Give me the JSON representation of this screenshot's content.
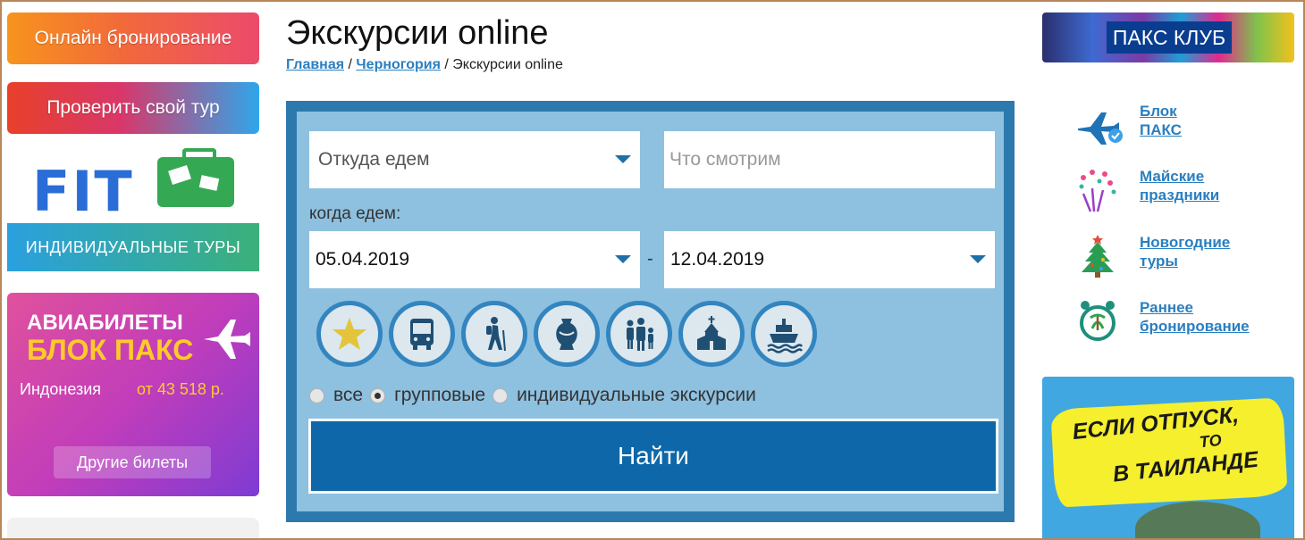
{
  "left": {
    "online_booking": "Онлайн бронирование",
    "check_tour": "Проверить свой тур",
    "fit": {
      "title": "FIT",
      "subtitle": "ИНДИВИДУАЛЬНЫЕ ТУРЫ"
    },
    "avia": {
      "line1": "АВИАБИЛЕТЫ",
      "line2": "БЛОК ПАКС",
      "country": "Индонезия",
      "price": "от 43 518  р.",
      "other": "Другие билеты"
    }
  },
  "main": {
    "title": "Экскурсии online",
    "breadcrumb": {
      "home": "Главная",
      "sep1": " / ",
      "country": "Черногория",
      "sep2": " / ",
      "current": "Экскурсии online"
    },
    "search": {
      "from_placeholder": "Откуда едем",
      "what_placeholder": "Что смотрим",
      "when_label": "когда едем:",
      "date_from": "05.04.2019",
      "date_sep": "-",
      "date_to": "12.04.2019",
      "categories": [
        "star-icon",
        "bus-icon",
        "hiker-icon",
        "amphora-icon",
        "family-icon",
        "church-icon",
        "ship-icon"
      ],
      "radio_all": "все",
      "radio_group": "групповые",
      "radio_individual": "индивидуальные экскурсии",
      "selected_radio": "групповые",
      "find_button": "Найти"
    }
  },
  "right": {
    "paks_club": "ПАКС КЛУБ",
    "links": [
      {
        "line1": "Блок",
        "line2": "ПАКС",
        "icon": "airplane-icon"
      },
      {
        "line1": "Майские",
        "line2": "праздники",
        "icon": "fireworks-icon"
      },
      {
        "line1": "Новогодние",
        "line2": "туры",
        "icon": "christmas-tree-icon"
      },
      {
        "line1": "Раннее",
        "line2": "бронирование",
        "icon": "alarm-clock-icon"
      }
    ],
    "thailand": {
      "line1": "ЕСЛИ ОТПУСК,",
      "line2": "ТО",
      "line3": "В ТАИЛАНДЕ"
    }
  },
  "colors": {
    "accent": "#0d67a8",
    "panel": "#8ec0e0",
    "panel_border": "#2c79ad",
    "link": "#2a7fc0"
  }
}
